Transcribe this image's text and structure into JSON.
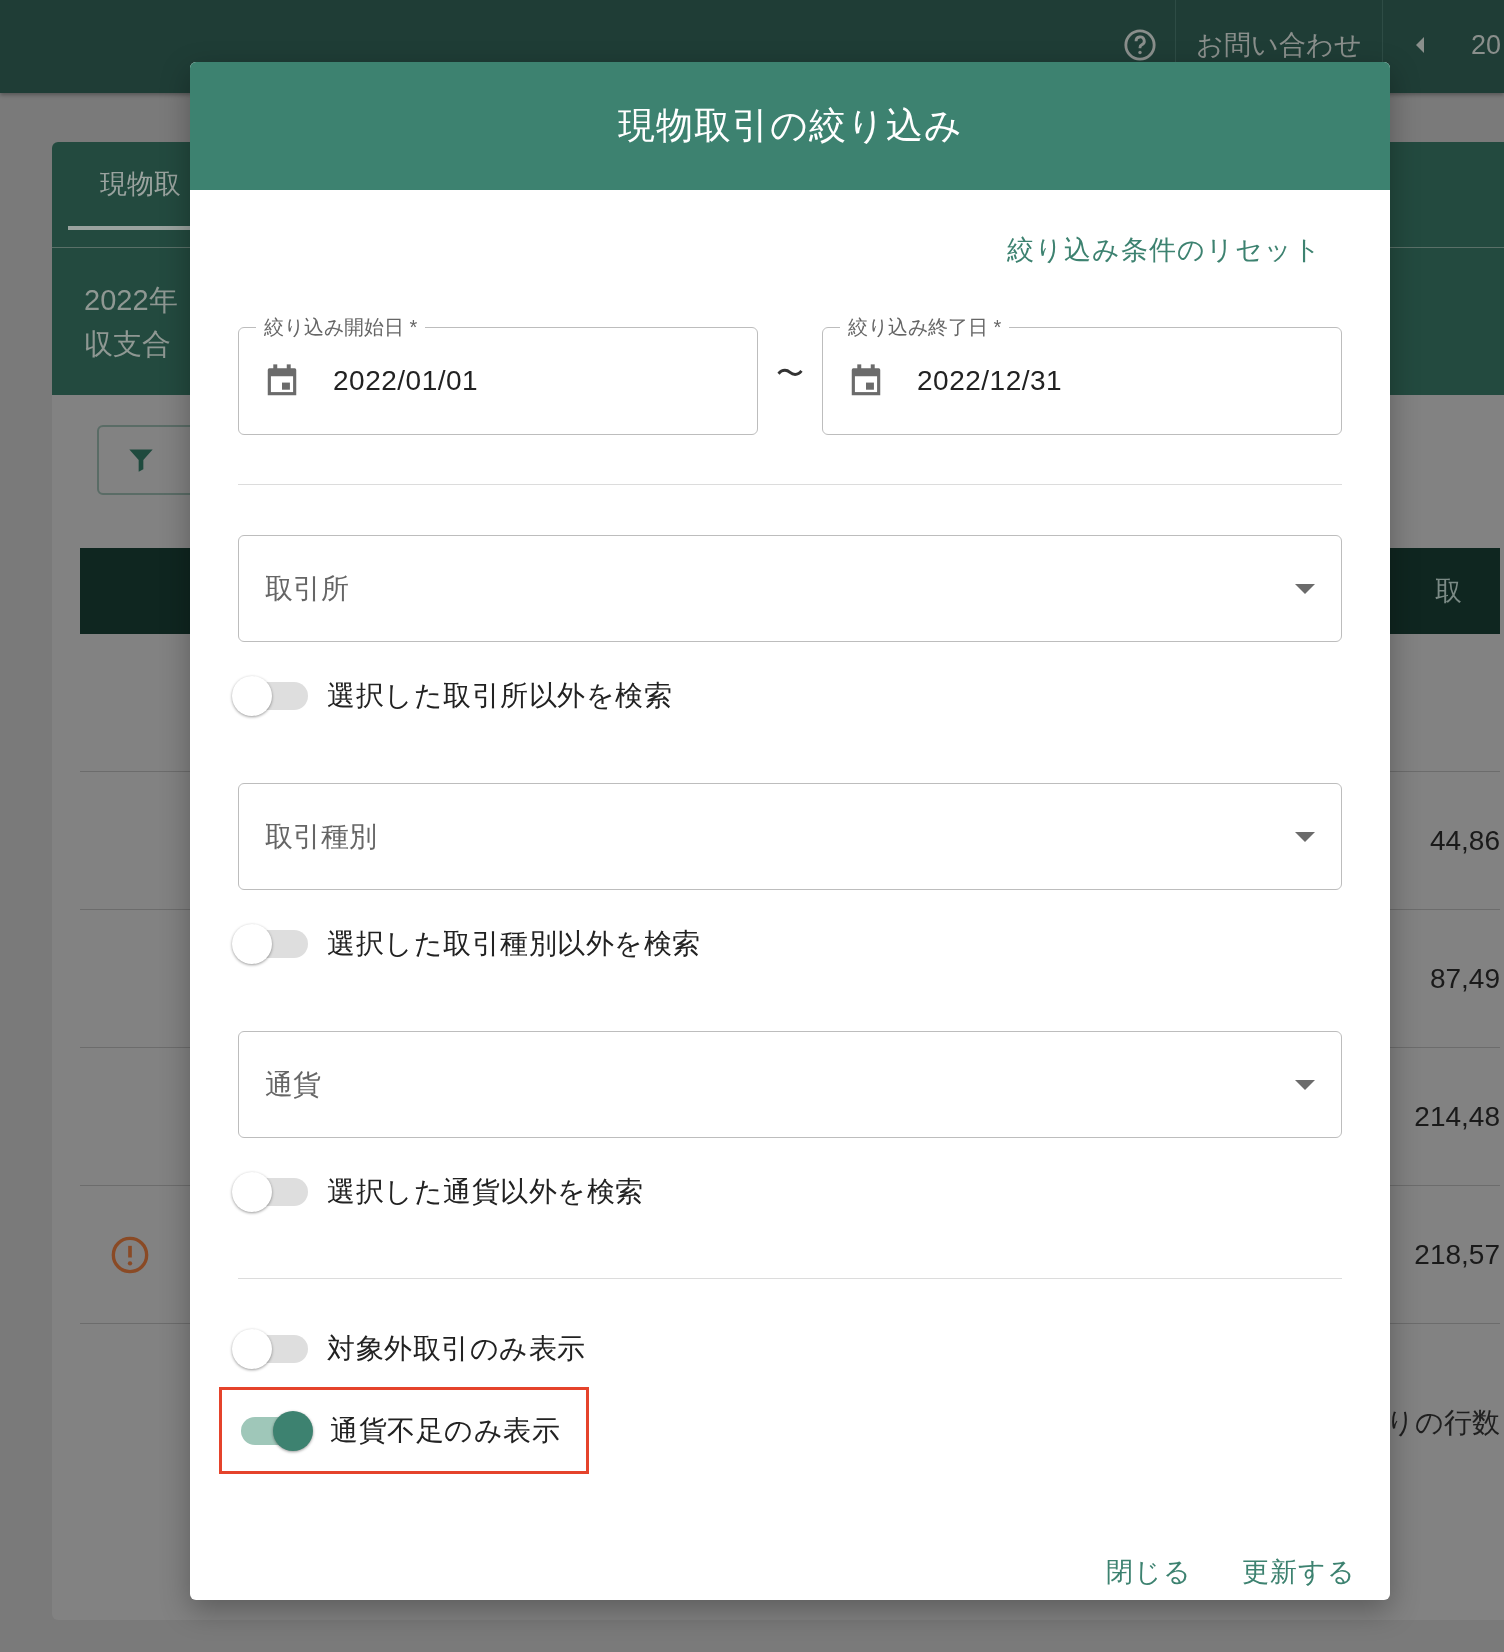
{
  "topbar": {
    "contact": "お問い合わせ",
    "page": "20"
  },
  "background": {
    "tab": "現物取",
    "summary": [
      "2022年",
      "収支合"
    ],
    "table": {
      "header": "取",
      "rows": [
        {
          "value": "",
          "warning": false
        },
        {
          "value": "44,86",
          "warning": false
        },
        {
          "value": "87,49",
          "warning": false
        },
        {
          "value": "214,48",
          "warning": false
        },
        {
          "value": "218,57",
          "warning": true
        }
      ]
    },
    "footer": "りの行数"
  },
  "dialog": {
    "title": "現物取引の絞り込み",
    "reset_link": "絞り込み条件のリセット",
    "date_start": {
      "label": "絞り込み開始日 *",
      "value": "2022/01/01"
    },
    "separator": "〜",
    "date_end": {
      "label": "絞り込み終了日 *",
      "value": "2022/12/31"
    },
    "filters": [
      {
        "placeholder": "取引所",
        "toggle": {
          "label": "選択した取引所以外を検索",
          "on": false
        }
      },
      {
        "placeholder": "取引種別",
        "toggle": {
          "label": "選択した取引種別以外を検索",
          "on": false
        }
      },
      {
        "placeholder": "通貨",
        "toggle": {
          "label": "選択した通貨以外を検索",
          "on": false
        }
      }
    ],
    "display_toggles": [
      {
        "label": "対象外取引のみ表示",
        "on": false,
        "highlighted": false
      },
      {
        "label": "通貨不足のみ表示",
        "on": true,
        "highlighted": true
      }
    ],
    "buttons": [
      "閉じる",
      "更新する"
    ]
  }
}
